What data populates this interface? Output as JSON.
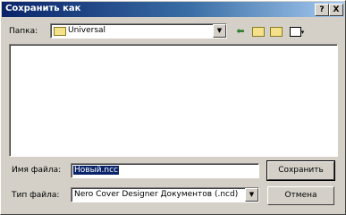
{
  "window": {
    "title": "Сохранить как",
    "help_label": "?",
    "close_label": "X"
  },
  "folder": {
    "label": "Папка:",
    "value": "Universal"
  },
  "filename": {
    "label": "Имя файла:",
    "value": "Новый.ncc"
  },
  "filetype": {
    "label": "Тип файла:",
    "value": "Nero Cover Designer Документов (.ncd)"
  },
  "buttons": {
    "save": "Сохранить",
    "cancel": "Отмена"
  },
  "icons": {
    "back": "back-arrow-icon",
    "up": "up-folder-icon",
    "new_folder": "new-folder-icon",
    "view": "view-menu-icon",
    "folder": "folder-icon",
    "dropdown": "chevron-down-icon"
  }
}
